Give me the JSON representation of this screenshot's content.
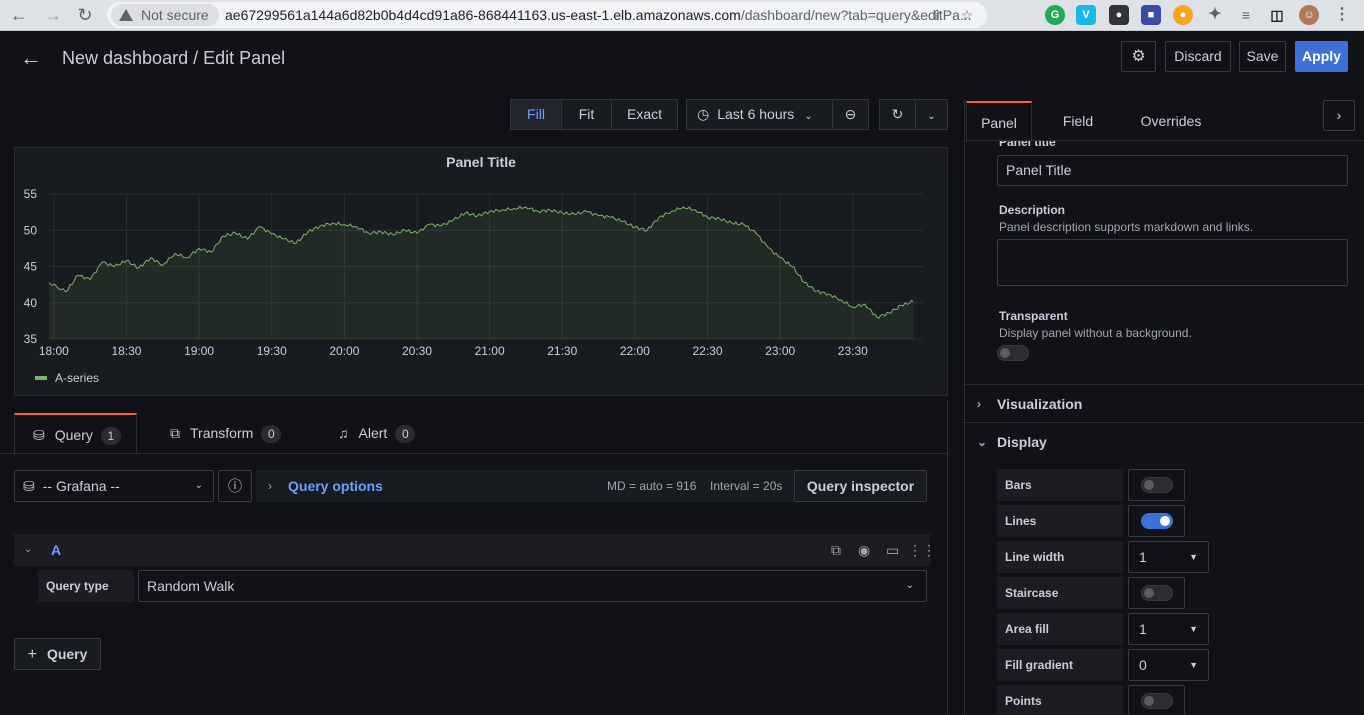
{
  "browser": {
    "security_label": "Not secure",
    "url_host": "ae67299561a144a6d82b0b4d4cd91a86-868441163.us-east-1.elb.amazonaws.com",
    "url_path": "/dashboard/new?tab=query&editPa..."
  },
  "header": {
    "title": "New dashboard / Edit Panel",
    "discard_label": "Discard",
    "save_label": "Save",
    "apply_label": "Apply"
  },
  "toolbar": {
    "fill_label": "Fill",
    "fit_label": "Fit",
    "exact_label": "Exact",
    "time_range": "Last 6 hours"
  },
  "panel": {
    "title": "Panel Title"
  },
  "chart_data": {
    "type": "line",
    "title": "Panel Title",
    "x": [
      "18:00",
      "18:30",
      "19:00",
      "19:30",
      "20:00",
      "20:30",
      "21:00",
      "21:30",
      "22:00",
      "22:30",
      "23:00",
      "23:30"
    ],
    "ylim": [
      35,
      55
    ],
    "yticks": [
      35,
      40,
      45,
      50,
      55
    ],
    "grid": true,
    "legend_placement": "bottom-left",
    "series": [
      {
        "name": "A-series",
        "color": "#7eb26d",
        "points": [
          [
            "17:58",
            42.8
          ],
          [
            "18:05",
            41.5
          ],
          [
            "18:10",
            43.8
          ],
          [
            "18:15",
            43.2
          ],
          [
            "18:20",
            45.6
          ],
          [
            "18:25",
            45.0
          ],
          [
            "18:30",
            45.8
          ],
          [
            "18:35",
            44.8
          ],
          [
            "18:40",
            46.2
          ],
          [
            "18:45",
            45.2
          ],
          [
            "18:50",
            46.8
          ],
          [
            "18:55",
            46.2
          ],
          [
            "19:00",
            47.5
          ],
          [
            "19:05",
            47.0
          ],
          [
            "19:10",
            49.2
          ],
          [
            "19:15",
            49.6
          ],
          [
            "19:20",
            48.8
          ],
          [
            "19:25",
            50.5
          ],
          [
            "19:30",
            49.5
          ],
          [
            "19:35",
            48.8
          ],
          [
            "19:40",
            48.2
          ],
          [
            "19:45",
            49.8
          ],
          [
            "19:50",
            50.6
          ],
          [
            "19:55",
            51.0
          ],
          [
            "20:00",
            50.8
          ],
          [
            "20:05",
            50.5
          ],
          [
            "20:10",
            49.6
          ],
          [
            "20:15",
            49.8
          ],
          [
            "20:20",
            49.4
          ],
          [
            "20:25",
            50.0
          ],
          [
            "20:30",
            49.6
          ],
          [
            "20:35",
            50.8
          ],
          [
            "20:40",
            50.6
          ],
          [
            "20:45",
            51.4
          ],
          [
            "20:50",
            52.4
          ],
          [
            "20:55",
            52.0
          ],
          [
            "21:00",
            52.6
          ],
          [
            "21:05",
            52.8
          ],
          [
            "21:10",
            53.0
          ],
          [
            "21:15",
            53.2
          ],
          [
            "21:20",
            52.6
          ],
          [
            "21:25",
            52.8
          ],
          [
            "21:30",
            52.4
          ],
          [
            "21:35",
            52.2
          ],
          [
            "21:40",
            52.6
          ],
          [
            "21:45",
            52.0
          ],
          [
            "21:50",
            51.8
          ],
          [
            "21:55",
            51.2
          ],
          [
            "22:00",
            50.4
          ],
          [
            "22:05",
            50.0
          ],
          [
            "22:10",
            51.8
          ],
          [
            "22:15",
            52.6
          ],
          [
            "22:20",
            53.2
          ],
          [
            "22:25",
            52.8
          ],
          [
            "22:30",
            51.8
          ],
          [
            "22:35",
            51.6
          ],
          [
            "22:40",
            51.0
          ],
          [
            "22:45",
            50.8
          ],
          [
            "22:50",
            49.6
          ],
          [
            "22:55",
            47.6
          ],
          [
            "23:00",
            46.2
          ],
          [
            "23:05",
            45.0
          ],
          [
            "23:10",
            42.8
          ],
          [
            "23:15",
            41.6
          ],
          [
            "23:20",
            41.2
          ],
          [
            "23:25",
            40.4
          ],
          [
            "23:30",
            39.4
          ],
          [
            "23:35",
            39.8
          ],
          [
            "23:40",
            38.0
          ],
          [
            "23:45",
            38.6
          ],
          [
            "23:50",
            39.6
          ],
          [
            "23:55",
            40.2
          ]
        ]
      }
    ]
  },
  "query_tabs": [
    {
      "label": "Query",
      "count": "1"
    },
    {
      "label": "Transform",
      "count": "0"
    },
    {
      "label": "Alert",
      "count": "0"
    }
  ],
  "query_editor": {
    "datasource": "-- Grafana --",
    "query_options_label": "Query options",
    "md_info": "MD = auto = 916",
    "interval_info": "Interval = 20s",
    "inspector_label": "Query inspector",
    "query_ref": "A",
    "query_type_label": "Query type",
    "query_type_value": "Random Walk",
    "add_query_label": "Query"
  },
  "options": {
    "tabs": [
      "Panel",
      "Field",
      "Overrides"
    ],
    "panel_title_label": "Panel title",
    "panel_title_value": "Panel Title",
    "description_label": "Description",
    "description_hint": "Panel description supports markdown and links.",
    "transparent_label": "Transparent",
    "transparent_hint": "Display panel without a background.",
    "visualization_label": "Visualization",
    "display_label": "Display",
    "display_rows": {
      "bars": {
        "label": "Bars",
        "on": false
      },
      "lines": {
        "label": "Lines",
        "on": true
      },
      "line_width": {
        "label": "Line width",
        "value": "1"
      },
      "staircase": {
        "label": "Staircase",
        "on": false
      },
      "area_fill": {
        "label": "Area fill",
        "value": "1"
      },
      "fill_gradient": {
        "label": "Fill gradient",
        "value": "0"
      },
      "points": {
        "label": "Points",
        "on": false
      }
    }
  },
  "colors": {
    "accent_blue": "#3d71d9",
    "tab_active_border": "#f55f3e",
    "link_blue": "#6e9fff",
    "series_green": "#7eb26d"
  }
}
